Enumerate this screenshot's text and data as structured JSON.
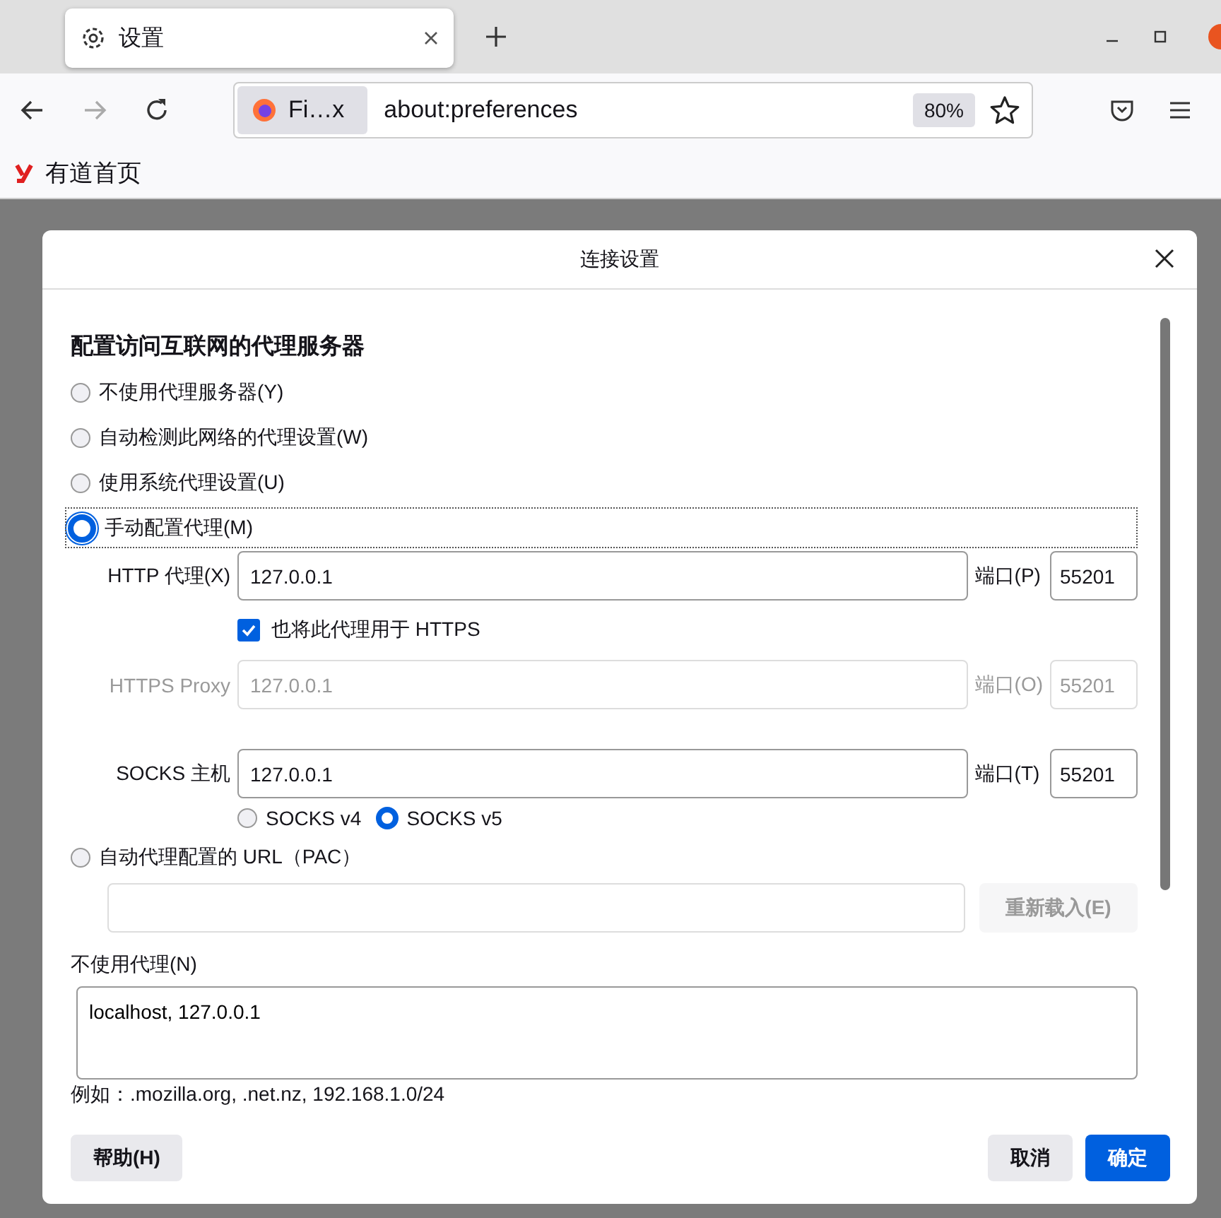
{
  "browser": {
    "tab": {
      "title": "设置"
    },
    "identity": "Fi…x",
    "url": "about:preferences",
    "zoom": "80%",
    "bookmarks": [
      {
        "label": "有道首页"
      }
    ]
  },
  "dialog": {
    "title": "连接设置",
    "heading": "配置访问互联网的代理服务器",
    "options": [
      {
        "label": "不使用代理服务器(Y)",
        "selected": false
      },
      {
        "label": "自动检测此网络的代理设置(W)",
        "selected": false
      },
      {
        "label": "使用系统代理设置(U)",
        "selected": false
      },
      {
        "label": "手动配置代理(M)",
        "selected": true
      },
      {
        "label": "自动代理配置的 URL（PAC）",
        "selected": false
      }
    ],
    "proxies": [
      {
        "label": "HTTP 代理(X)",
        "value": "127.0.0.1",
        "port_label": "端口(P)",
        "port": "55201",
        "disabled": false
      },
      {
        "label": "HTTPS Proxy",
        "value": "127.0.0.1",
        "port_label": "端口(O)",
        "port": "55201",
        "disabled": true
      },
      {
        "label": "SOCKS 主机",
        "value": "127.0.0.1",
        "port_label": "端口(T)",
        "port": "55201",
        "disabled": false
      }
    ],
    "also_https": {
      "label": "也将此代理用于 HTTPS",
      "checked": true
    },
    "socks_versions": [
      {
        "label": "SOCKS v4",
        "selected": false
      },
      {
        "label": "SOCKS v5",
        "selected": true
      }
    ],
    "pac": {
      "reload": "重新载入(E)"
    },
    "no_proxy": {
      "label": "不使用代理(N)",
      "value": "localhost, 127.0.0.1",
      "example": "例如：.mozilla.org, .net.nz, 192.168.1.0/24"
    },
    "buttons": {
      "help": "帮助(H)",
      "cancel": "取消",
      "ok": "确定"
    }
  }
}
